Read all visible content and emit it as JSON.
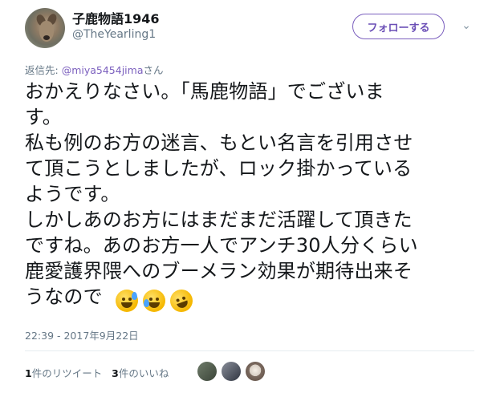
{
  "author": {
    "display_name": "子鹿物語1946",
    "handle": "@TheYearling1",
    "avatar_icon": "deer-avatar"
  },
  "actions": {
    "follow_label": "フォローする",
    "more_icon": "chevron-down-icon"
  },
  "reply": {
    "prefix": "返信先: ",
    "mention": "@miya5454jima",
    "suffix": "さん"
  },
  "tweet": {
    "lines": [
      "おかえりなさい。「馬鹿物語」でございま",
      "す。",
      "私も例のお方の迷言、もとい名言を引用させ",
      "て頂こうとしましたが、ロック掛かっている",
      "ようです。",
      "しかしあのお方にはまだまだ活躍して頂きた",
      "ですね。あのお方一人でアンチ30人分くらい",
      "鹿愛護界隈へのブーメラン効果が期待出来そ",
      "うなので"
    ],
    "emojis": [
      "grinning-sweat-emoji",
      "joy-emoji",
      "rofl-emoji"
    ]
  },
  "timestamp": "22:39 - 2017年9月22日",
  "stats": {
    "retweet_count": "1",
    "retweet_label": "件のリツイート",
    "like_count": "3",
    "like_label": "件のいいね"
  },
  "colors": {
    "accent": "#7b5fbe",
    "text": "#14171a",
    "muted": "#657786",
    "divider": "#e6ecf0"
  }
}
